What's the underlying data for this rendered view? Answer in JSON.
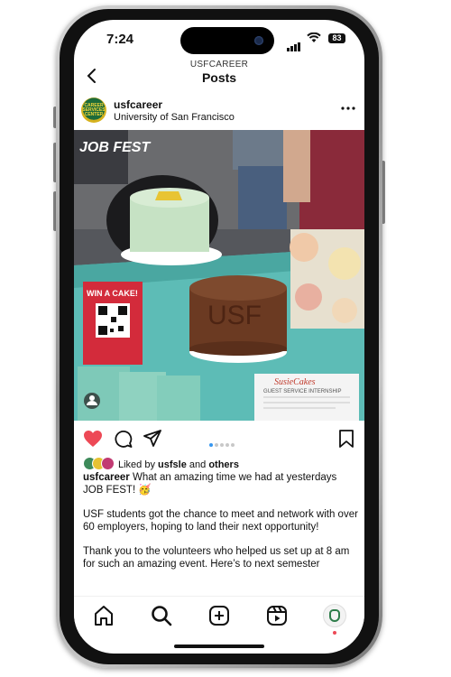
{
  "status_bar": {
    "time": "7:24",
    "battery": "83"
  },
  "header": {
    "username": "USFCAREER",
    "title": "Posts"
  },
  "post": {
    "handle": "usfcareer",
    "location": "University of San Francisco",
    "avatar_text": "CAREER SERVICES CENTER",
    "photo_text": {
      "job_fest": "JOB FEST",
      "sign": "WIN A CAKE!",
      "cake_label": "USF",
      "brand": "SusieCakes",
      "doc_title": "GUEST SERVICE INTERNSHIP"
    },
    "carousel": {
      "count": 5,
      "active": 0
    },
    "liked_prefix": "Liked by",
    "liked_user": "usfsle",
    "liked_and": "and",
    "liked_others": "others",
    "caption_user": "usfcareer",
    "caption_line1": "What an amazing time we had at yesterdays JOB FEST! 🥳",
    "caption_para2": "USF students got the chance to meet and network with over 60 employers, hoping to land their next opportunity!",
    "caption_para3": "Thank you to the volunteers who helped us set up at 8 am for such an amazing event. Here’s to next semester"
  },
  "icons": {
    "back": "chevron-left-icon",
    "more": "more-horizontal-icon",
    "like": "heart-icon",
    "comment": "comment-icon",
    "share": "send-icon",
    "save": "bookmark-icon",
    "tabs": [
      "home-icon",
      "search-icon",
      "create-icon",
      "reels-icon",
      "profile-icon"
    ]
  },
  "colors": {
    "like": "#ed4956",
    "carousel_active": "#3797f0",
    "brand_green": "#1d6b3a"
  }
}
